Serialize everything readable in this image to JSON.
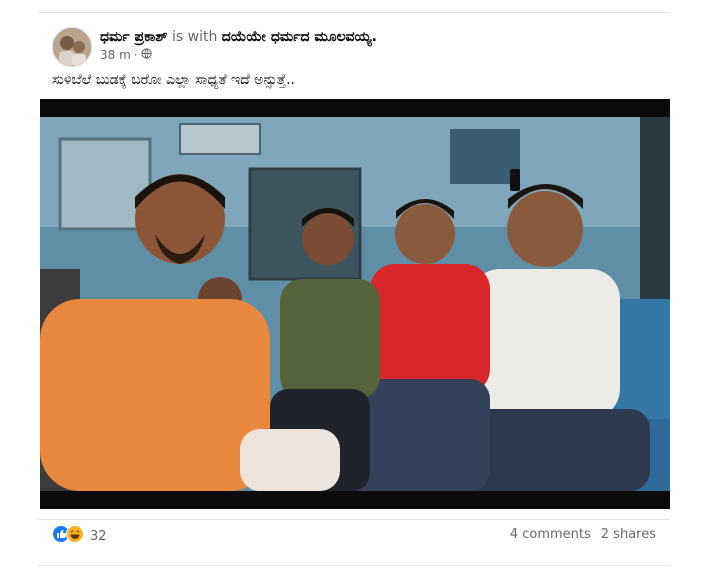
{
  "post": {
    "author": "ಧರ್ಮ ಪ್ರಕಾಶ್",
    "with_text": "is with",
    "group": "ದಯೆಯೇ ಧರ್ಮದ ಮೂಲವಯ್ಯ.",
    "time": "38 m",
    "separator": "·",
    "privacy_icon": "globe-icon",
    "text": "ಸುಳಿಬೆಲೆ ಬುಡಕ್ಕೆ ಬರೋ ಎಲ್ಲಾ ಸಾಧ್ಯತೆ ಇದೆ ಅನ್ಸುತ್ತೆ.."
  },
  "footer": {
    "reaction_icons": [
      "like-icon",
      "haha-icon"
    ],
    "reaction_count": "32",
    "comments": "4 comments",
    "shares": "2 shares"
  },
  "colors": {
    "like_blue": "#1877f2",
    "haha_yellow": "#f7b125",
    "text_primary": "#050505",
    "text_secondary": "#65676b"
  }
}
